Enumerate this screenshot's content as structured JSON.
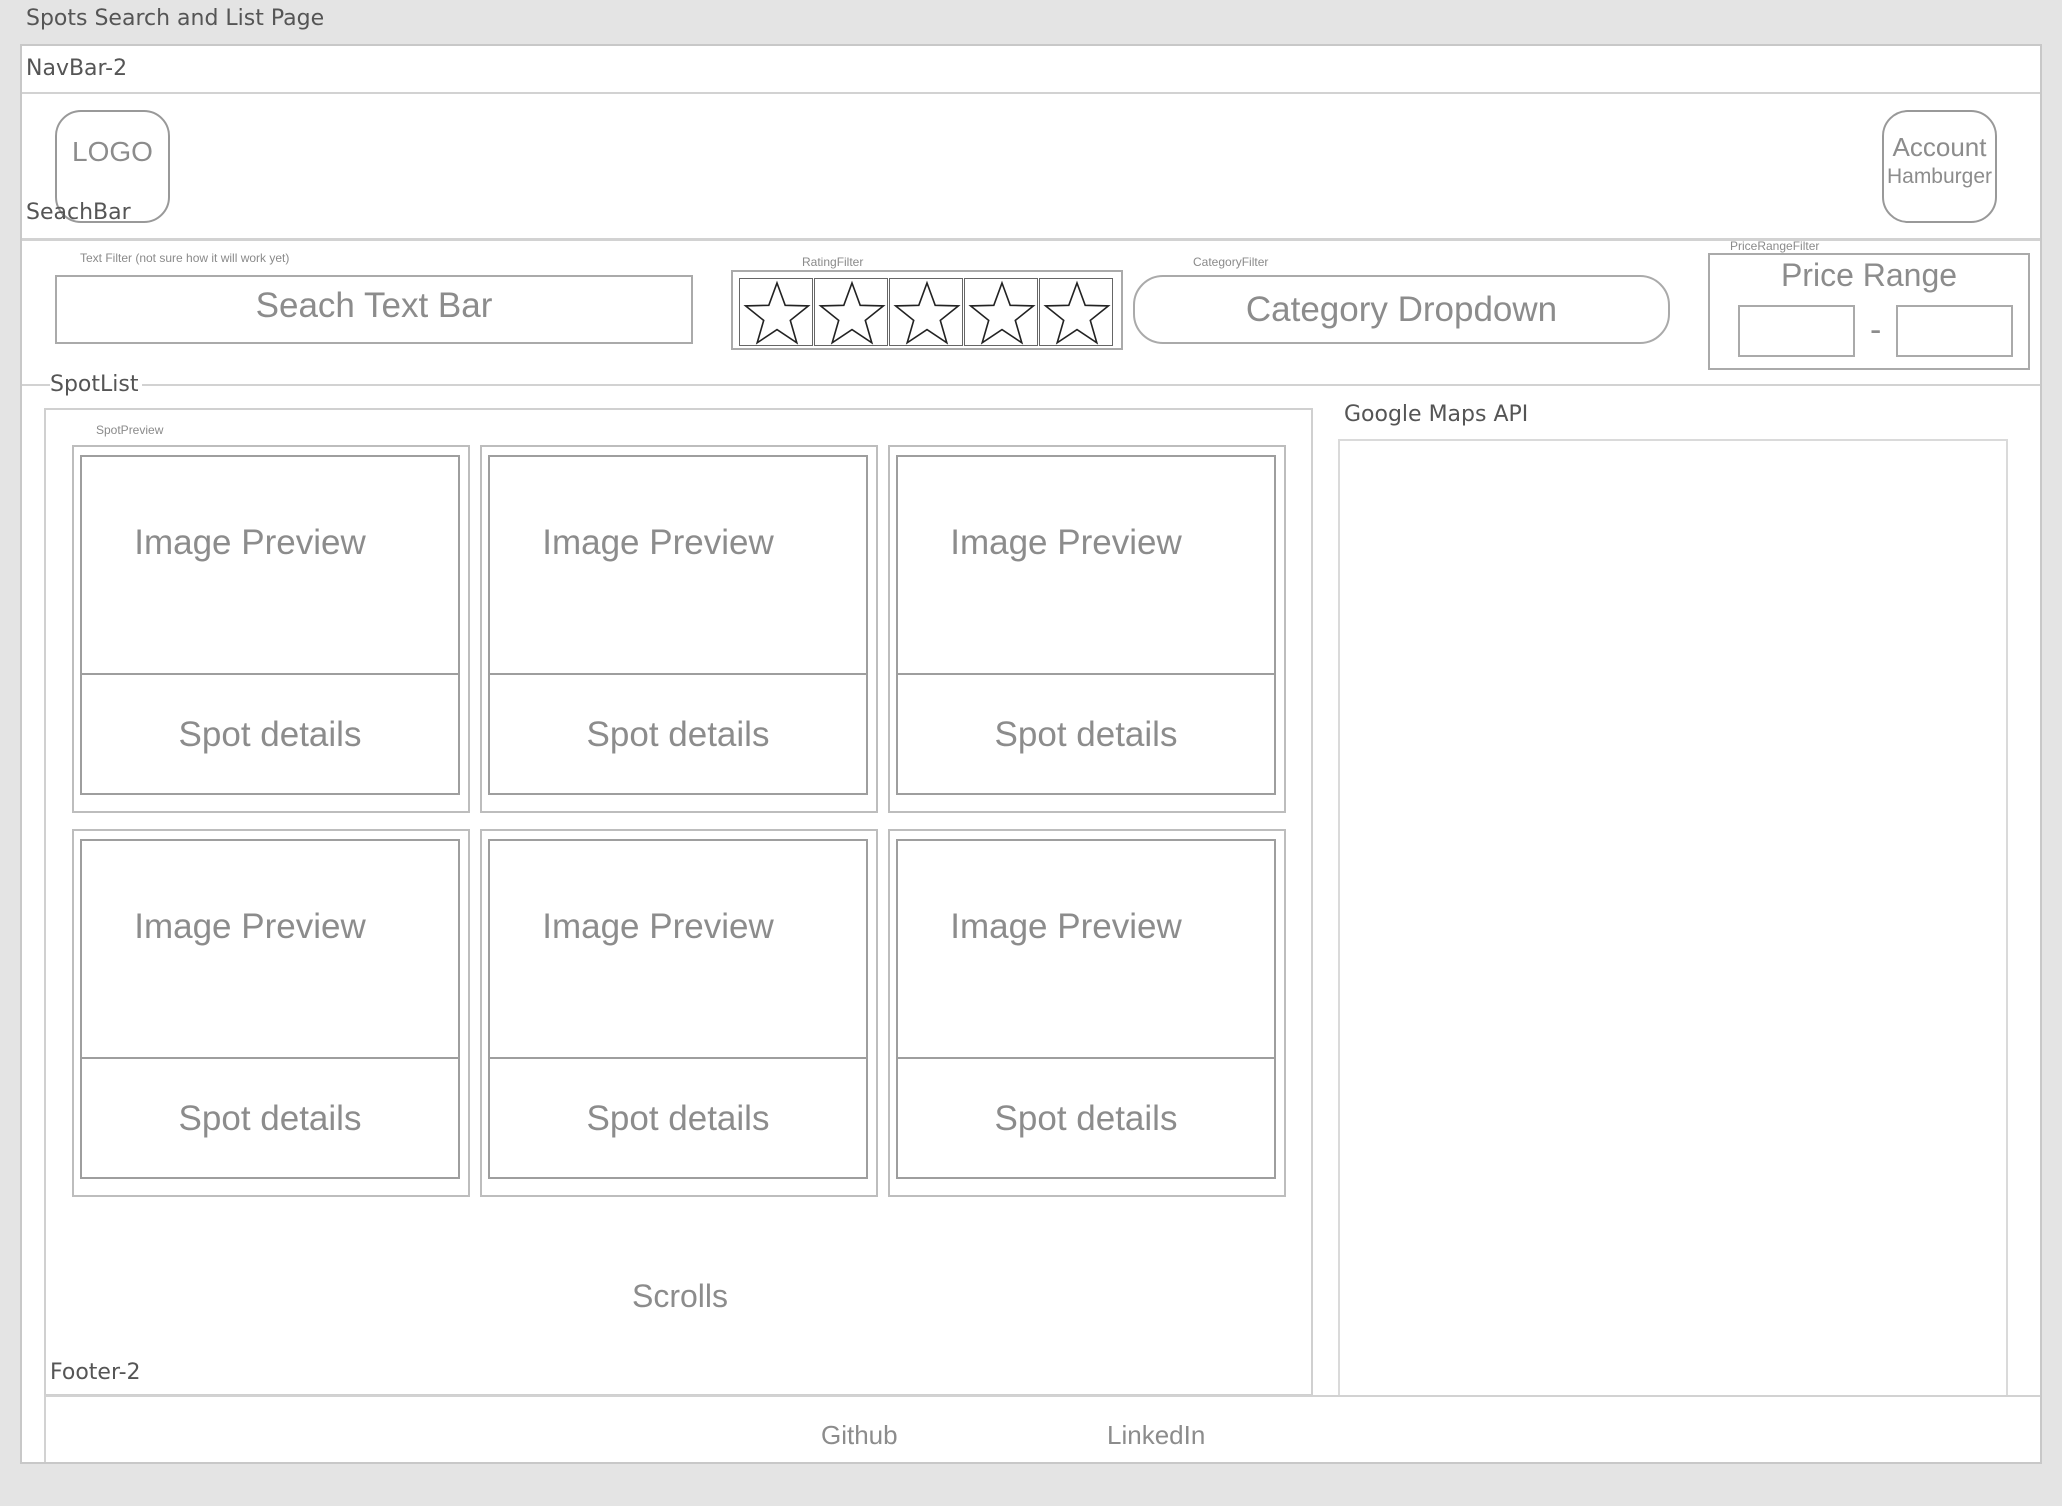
{
  "page": {
    "title": "Spots Search and List Page"
  },
  "navbar": {
    "label": "NavBar-2",
    "logo": "LOGO",
    "account_line1": "Account",
    "account_line2": "Hamburger"
  },
  "searchbar": {
    "label": "SeachBar",
    "text_filter_label": "Text Filter (not sure how it will work yet)",
    "search_text": "Seach Text Bar",
    "rating_filter_label": "RatingFilter",
    "star_count": 5,
    "category_filter_label": "CategoryFilter",
    "category_text": "Category Dropdown",
    "price_filter_label": "PriceRangeFilter",
    "price_title": "Price Range",
    "price_separator": "-"
  },
  "spotlist": {
    "label": "SpotList",
    "preview_label": "SpotPreview",
    "cards": [
      {
        "image": "Image Preview",
        "details": "Spot details"
      },
      {
        "image": "Image Preview",
        "details": "Spot details"
      },
      {
        "image": "Image Preview",
        "details": "Spot details"
      },
      {
        "image": "Image Preview",
        "details": "Spot details"
      },
      {
        "image": "Image Preview",
        "details": "Spot details"
      },
      {
        "image": "Image Preview",
        "details": "Spot details"
      }
    ],
    "scroll_text": "Scrolls"
  },
  "map": {
    "label": "Google Maps API"
  },
  "footer": {
    "label": "Footer-2",
    "links": [
      "Github",
      "LinkedIn"
    ]
  }
}
